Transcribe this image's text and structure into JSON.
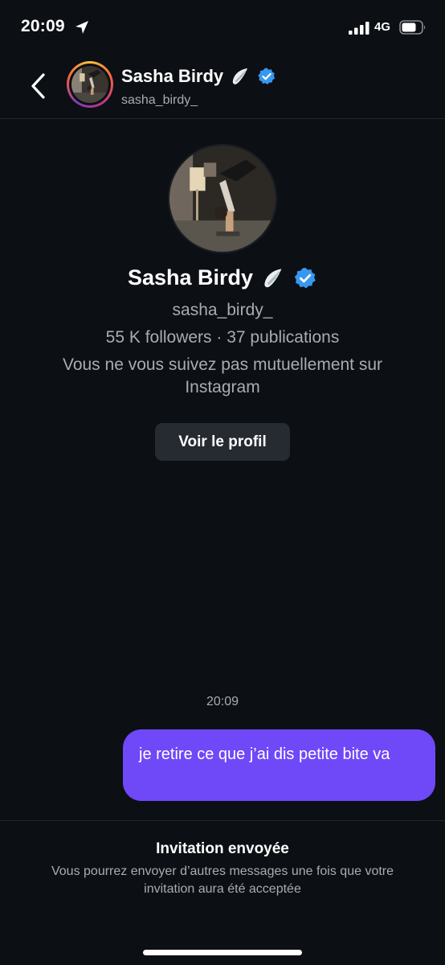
{
  "status_bar": {
    "time": "20:09",
    "network": "4G",
    "icons": [
      "location-arrow-icon",
      "signal-icon",
      "battery-icon"
    ]
  },
  "header": {
    "back_icon": "chevron-left-icon",
    "display_name": "Sasha Birdy",
    "username": "sasha_birdy_",
    "wing_icon": "angel-wing-emoji-icon",
    "verified_icon": "verified-badge-icon"
  },
  "profile": {
    "display_name": "Sasha Birdy",
    "username": "sasha_birdy_",
    "stats": "55 K followers · 37 publications",
    "mutual_note": "Vous ne vous suivez pas mutuellement sur Instagram",
    "view_profile_label": "Voir le profil"
  },
  "conversation": {
    "timestamp": "20:09",
    "messages": [
      {
        "from": "me",
        "text": "je retire ce que j’ai dis petite bite va"
      }
    ]
  },
  "footer": {
    "title": "Invitation envoyée",
    "description": "Vous pourrez envoyer d’autres messages une fois que votre invitation aura été acceptée"
  },
  "colors": {
    "background": "#0c0f14",
    "bubble": "#6f48f7",
    "secondary_text": "#a8acb3",
    "button_bg": "#262a31",
    "verified": "#3897f0"
  }
}
